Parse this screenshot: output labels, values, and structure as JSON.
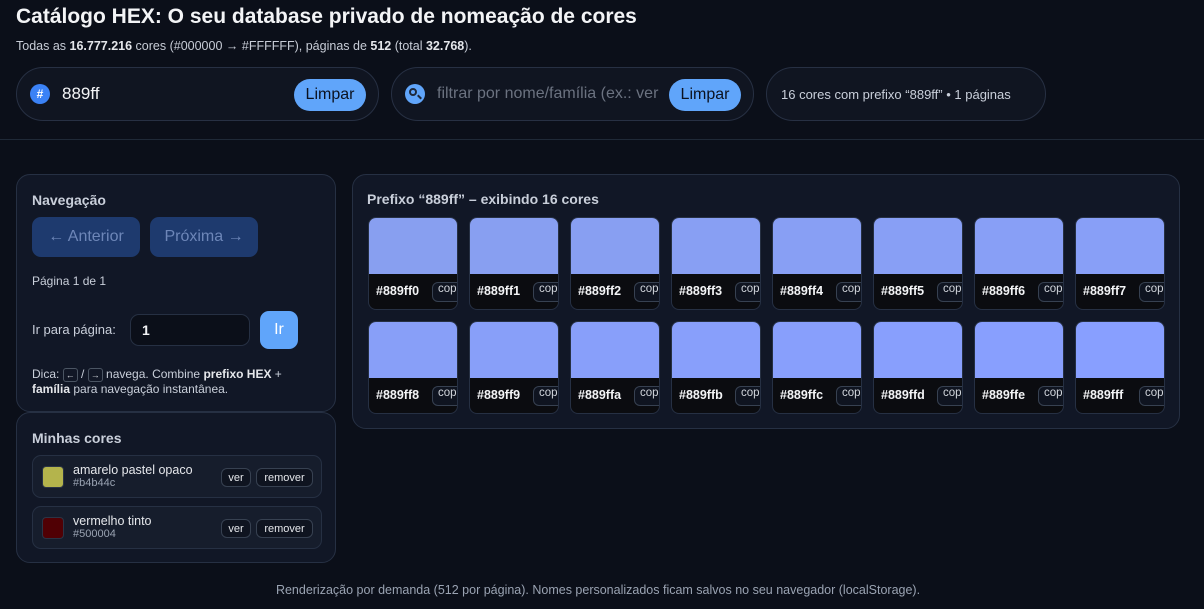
{
  "header": {
    "title": "Catálogo HEX: O seu database privado de nomeação de cores",
    "sub_pre": "Todas as ",
    "sub_total": "16.777.216",
    "sub_mid": " cores (#000000 → #FFFFFF), páginas de ",
    "sub_pagesize": "512",
    "sub_mid2": " (total ",
    "sub_pages": "32.768",
    "sub_end": ")."
  },
  "prefix": {
    "icon": "#",
    "value": "889ff",
    "clear_label": "Limpar"
  },
  "filter": {
    "placeholder": "filtrar por nome/família (ex.: verde, azul...)",
    "value": "",
    "clear_label": "Limpar"
  },
  "count_text": "16 cores com prefixo “889ff” • 1 páginas",
  "nav": {
    "heading": "Navegação",
    "prev_label": "← Anterior",
    "next_label": "Próxima →",
    "page_info": "Página 1 de 1",
    "goto_label": "Ir para página:",
    "goto_value": "1",
    "go_label": "Ir",
    "tip_pre": "Dica: ",
    "tip_key1": "←",
    "tip_sep": " / ",
    "tip_key2": "→",
    "tip_mid": " navega. Combine ",
    "tip_b1": "prefixo HEX",
    "tip_plus": " + ",
    "tip_b2": "família",
    "tip_end": " para navegação instantânea."
  },
  "mine": {
    "heading": "Minhas cores",
    "items": [
      {
        "name": "amarelo pastel opaco",
        "hex": "#b4b44c",
        "color": "#b4b44c",
        "view_label": "ver",
        "remove_label": "remover"
      },
      {
        "name": "vermelho tinto",
        "hex": "#500004",
        "color": "#500004",
        "view_label": "ver",
        "remove_label": "remover"
      }
    ]
  },
  "grid": {
    "heading": "Prefixo “889ff” – exibindo 16 cores",
    "copy_label": "copiar",
    "swatches": [
      {
        "hex": "#889ff0",
        "color": "#889ff0"
      },
      {
        "hex": "#889ff1",
        "color": "#889ff1"
      },
      {
        "hex": "#889ff2",
        "color": "#889ff2"
      },
      {
        "hex": "#889ff3",
        "color": "#889ff3"
      },
      {
        "hex": "#889ff4",
        "color": "#889ff4"
      },
      {
        "hex": "#889ff5",
        "color": "#889ff5"
      },
      {
        "hex": "#889ff6",
        "color": "#889ff6"
      },
      {
        "hex": "#889ff7",
        "color": "#889ff7"
      },
      {
        "hex": "#889ff8",
        "color": "#889ff8"
      },
      {
        "hex": "#889ff9",
        "color": "#889ff9"
      },
      {
        "hex": "#889ffa",
        "color": "#889ffa"
      },
      {
        "hex": "#889ffb",
        "color": "#889ffb"
      },
      {
        "hex": "#889ffc",
        "color": "#889ffc"
      },
      {
        "hex": "#889ffd",
        "color": "#889ffd"
      },
      {
        "hex": "#889ffe",
        "color": "#889ffe"
      },
      {
        "hex": "#889fff",
        "color": "#889fff"
      }
    ]
  },
  "footer": "Renderização por demanda (512 por página). Nomes personalizados ficam salvos no seu navegador (localStorage).",
  "colors": {
    "background": "#0b0f19",
    "accent": "#60a5fa",
    "panel": "#111726"
  }
}
